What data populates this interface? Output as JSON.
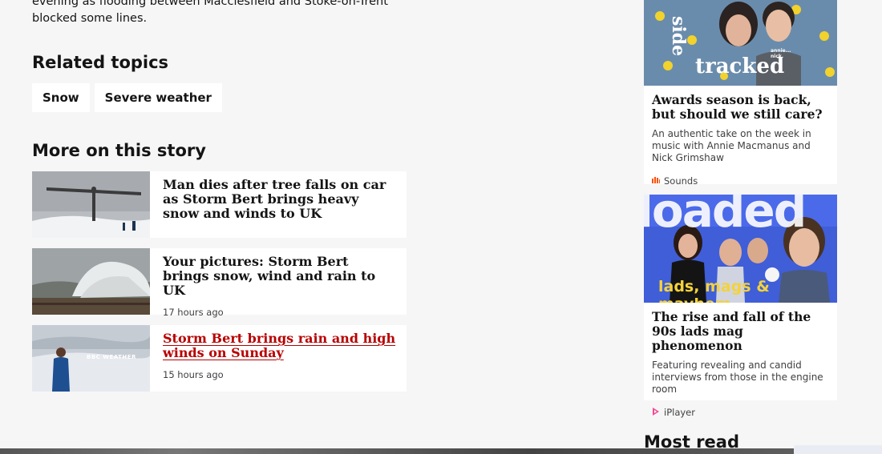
{
  "article": {
    "intro": "evening as flooding between Macclesfield and Stoke-on-Trent blocked some lines."
  },
  "related": {
    "heading": "Related topics",
    "topics": [
      "Snow",
      "Severe weather"
    ]
  },
  "more": {
    "heading": "More on this story",
    "stories": [
      {
        "title": "Man dies after tree falls on car as Storm Bert brings heavy snow and winds to UK",
        "time": ""
      },
      {
        "title": "Your pictures: Storm Bert brings snow, wind and rain to UK",
        "time": "17 hours ago"
      },
      {
        "title": "Storm Bert brings rain and high winds on Sunday",
        "time": "15 hours ago",
        "thumb_caption": "BBC WEATHER"
      }
    ]
  },
  "promos": [
    {
      "image_text_1": "side",
      "image_text_2": "tracked",
      "image_text_3": "annie... nick.",
      "title": "Awards season is back, but should we still care?",
      "desc": "An authentic take on the week in music with Annie Macmanus and Nick Grimshaw",
      "source": "Sounds",
      "source_icon": "sounds-icon",
      "accent": "#ff4f00"
    },
    {
      "image_text_1": "loaded",
      "image_text_2": "lads, mags & mayhem",
      "title": "The rise and fall of the 90s lads mag phenomenon",
      "desc": "Featuring revealing and candid interviews from those in the engine room",
      "source": "iPlayer",
      "source_icon": "iplayer-icon",
      "accent": "#f54997"
    }
  ],
  "most_read": {
    "heading": "Most read"
  }
}
